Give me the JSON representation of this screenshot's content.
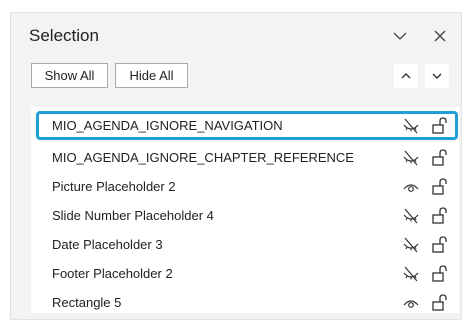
{
  "pane": {
    "title": "Selection",
    "collapse_icon": "chevron-down-icon",
    "close_icon": "close-icon"
  },
  "toolbar": {
    "show_all_label": "Show All",
    "hide_all_label": "Hide All",
    "bring_forward_icon": "caret-up-icon",
    "send_backward_icon": "caret-down-icon"
  },
  "colors": {
    "selection_outline": "#1f9fd8",
    "pane_background": "#f3f3f3",
    "list_background": "#ffffff"
  },
  "items": [
    {
      "label": "MIO_AGENDA_IGNORE_NAVIGATION",
      "visible": false,
      "locked": false,
      "selected": true
    },
    {
      "label": "MIO_AGENDA_IGNORE_CHAPTER_REFERENCE",
      "visible": false,
      "locked": false,
      "selected": false
    },
    {
      "label": "Picture Placeholder 2",
      "visible": true,
      "locked": false,
      "selected": false
    },
    {
      "label": "Slide Number Placeholder 4",
      "visible": false,
      "locked": false,
      "selected": false
    },
    {
      "label": "Date Placeholder 3",
      "visible": false,
      "locked": false,
      "selected": false
    },
    {
      "label": "Footer Placeholder 2",
      "visible": false,
      "locked": false,
      "selected": false
    },
    {
      "label": "Rectangle 5",
      "visible": true,
      "locked": false,
      "selected": false
    }
  ]
}
